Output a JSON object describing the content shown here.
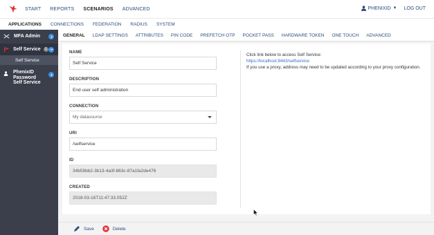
{
  "topnav": {
    "items": [
      {
        "label": "START"
      },
      {
        "label": "REPORTS"
      },
      {
        "label": "SCENARIOS",
        "active": true
      },
      {
        "label": "ADVANCED"
      }
    ],
    "user": "PHENIXID",
    "logout": "LOG OUT"
  },
  "subnav": {
    "items": [
      {
        "label": "APPLICATIONS",
        "active": true
      },
      {
        "label": "CONNECTIONS"
      },
      {
        "label": "FEDERATION"
      },
      {
        "label": "RADIUS"
      },
      {
        "label": "SYSTEM"
      }
    ]
  },
  "sidebar": {
    "mfa_admin": "MFA Admin",
    "self_service": "Self Service",
    "self_service_badge": "1",
    "self_service_sub": "Self Service",
    "phenix_pss": "PhenixID Password Self Service"
  },
  "tabs": {
    "items": [
      {
        "label": "GENERAL",
        "active": true
      },
      {
        "label": "LDAP SETTINGS"
      },
      {
        "label": "ATTRIBUTES"
      },
      {
        "label": "PIN CODE"
      },
      {
        "label": "PREFETCH OTP"
      },
      {
        "label": "POCKET PASS"
      },
      {
        "label": "HARDWARE TOKEN"
      },
      {
        "label": "ONE TOUCH"
      },
      {
        "label": "ADVANCED"
      }
    ]
  },
  "form": {
    "name_label": "NAME",
    "name_value": "Self Service",
    "description_label": "DESCRIPTION",
    "description_value": "End user self administration",
    "connection_label": "CONNECTION",
    "connection_value": "My datasource",
    "uri_label": "URI",
    "uri_value": "/selfservice",
    "id_label": "ID",
    "id_value": "34b59bb2-3b13-4a3f-863c-87a1fa2de476",
    "created_label": "CREATED",
    "created_value": "2018-03-16T11:47:33.052Z"
  },
  "info": {
    "line1": "Click link below to access Self Service:",
    "link": "https://localhost:8443/selfservice",
    "line2": "If you use a proxy, address may need to be updated according to your proxy configuration."
  },
  "footer": {
    "save": "Save",
    "delete": "Delete"
  },
  "colors": {
    "accent_blue": "#3b8fe4",
    "delete_red": "#e0353b",
    "sidebar_bg": "#3a3f4b",
    "brand_red": "#d9322f"
  },
  "icons": {
    "logo": "phoenix-logo-icon",
    "user": "user-icon",
    "mfa": "tools-icon",
    "self_service": "flag-icon",
    "phenix_pss": "person-icon",
    "save": "pencil-icon",
    "delete": "close-circle-icon"
  }
}
